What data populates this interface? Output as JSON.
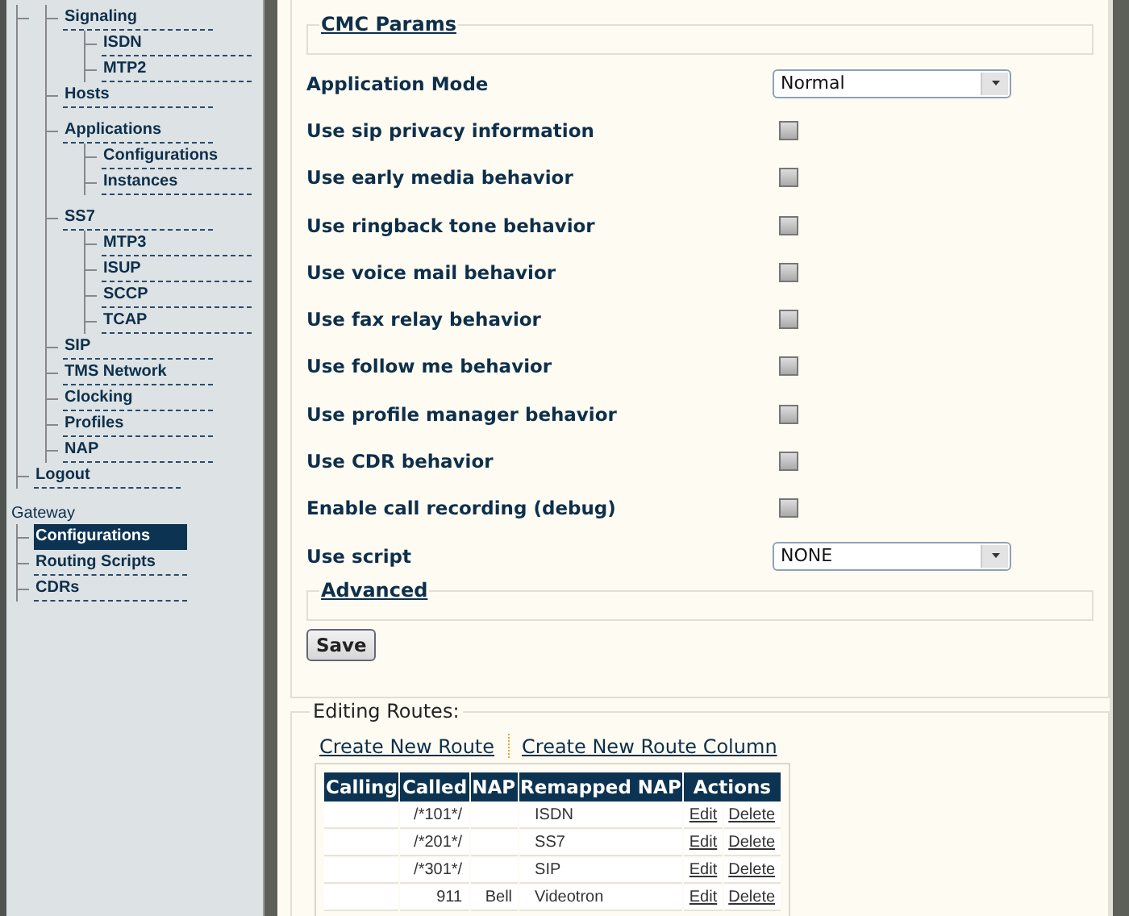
{
  "sidebar": {
    "tree": [
      {
        "children": [
          {
            "label": "Signaling",
            "selected": false,
            "children": [
              {
                "label": "ISDN",
                "selected": false
              },
              {
                "label": "MTP2",
                "selected": false
              }
            ]
          },
          {
            "label": "Hosts",
            "selected": false
          },
          {
            "label": "Applications",
            "selected": false,
            "children": [
              {
                "label": "Configurations",
                "selected": false
              },
              {
                "label": "Instances",
                "selected": false
              }
            ]
          },
          {
            "label": "SS7",
            "selected": false,
            "children": [
              {
                "label": "MTP3",
                "selected": false
              },
              {
                "label": "ISUP",
                "selected": false
              },
              {
                "label": "SCCP",
                "selected": false
              },
              {
                "label": "TCAP",
                "selected": false
              }
            ]
          },
          {
            "label": "SIP",
            "selected": false
          },
          {
            "label": "TMS Network",
            "selected": false
          },
          {
            "label": "Clocking",
            "selected": false
          },
          {
            "label": "Profiles",
            "selected": false
          },
          {
            "label": "NAP",
            "selected": false
          }
        ]
      },
      {
        "label": "Logout",
        "selected": false
      }
    ],
    "gateway": {
      "title": "Gateway",
      "items": [
        {
          "label": "Configurations",
          "selected": true
        },
        {
          "label": "Routing Scripts",
          "selected": false
        },
        {
          "label": "CDRs",
          "selected": false
        }
      ]
    }
  },
  "cmc_params": {
    "legend": "CMC Params",
    "fields": [
      {
        "kind": "select",
        "label": "Application Mode",
        "value": "Normal"
      },
      {
        "kind": "checkbox",
        "label": "Use sip privacy information",
        "checked": false
      },
      {
        "kind": "checkbox",
        "label": "Use early media behavior",
        "checked": false
      },
      {
        "kind": "checkbox",
        "label": "Use ringback tone behavior",
        "checked": false
      },
      {
        "kind": "checkbox",
        "label": "Use voice mail behavior",
        "checked": false
      },
      {
        "kind": "checkbox",
        "label": "Use fax relay behavior",
        "checked": false
      },
      {
        "kind": "checkbox",
        "label": "Use follow me behavior",
        "checked": false
      },
      {
        "kind": "checkbox",
        "label": "Use profile manager behavior",
        "checked": false
      },
      {
        "kind": "checkbox",
        "label": "Use CDR behavior",
        "checked": false
      },
      {
        "kind": "checkbox",
        "label": "Enable call recording (debug)",
        "checked": false
      },
      {
        "kind": "select",
        "label": "Use script",
        "value": "NONE"
      }
    ]
  },
  "advanced": {
    "legend": "Advanced"
  },
  "save_button": "Save",
  "routes": {
    "legend": "Editing Routes:",
    "links": [
      "Create New Route",
      "Create New Route Column"
    ],
    "columns": [
      "Calling",
      "Called",
      "NAP",
      "Remapped NAP",
      "Actions"
    ],
    "rows": [
      {
        "cells": [
          "",
          "/*101*/",
          "",
          "ISDN"
        ],
        "actions": [
          "Edit",
          "Delete"
        ]
      },
      {
        "cells": [
          "",
          "/*201*/",
          "",
          "SS7"
        ],
        "actions": [
          "Edit",
          "Delete"
        ]
      },
      {
        "cells": [
          "",
          "/*301*/",
          "",
          "SIP"
        ],
        "actions": [
          "Edit",
          "Delete"
        ]
      },
      {
        "cells": [
          "",
          "911",
          "Bell",
          "Videotron"
        ],
        "actions": [
          "Edit",
          "Delete"
        ]
      }
    ]
  }
}
